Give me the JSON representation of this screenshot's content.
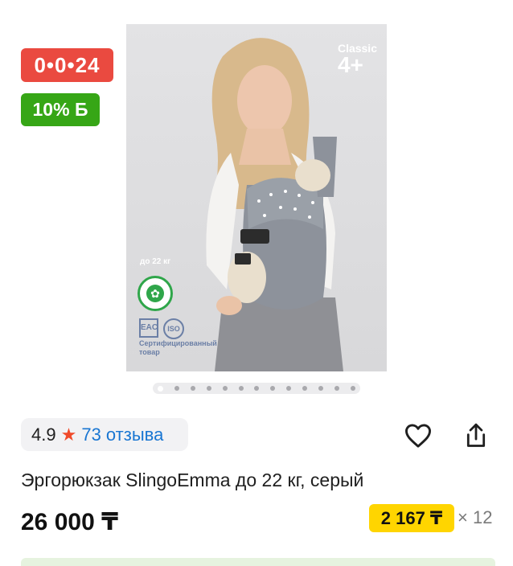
{
  "badges": {
    "timer": "0•0•24",
    "bonus": "10% Б"
  },
  "product_image": {
    "series": "Classic",
    "age": "4+",
    "weight_label": "до 22 кг",
    "cotton_badge": "100% COTTON",
    "cert_logos": [
      "EAC",
      "ISO"
    ],
    "certified_text": "Сертифицированный товар",
    "slides_total": 13,
    "slide_active": 1
  },
  "rating": {
    "score": "4.9",
    "reviews": "73 отзыва"
  },
  "actions": {
    "favorite_icon": "heart-icon",
    "share_icon": "share-icon"
  },
  "product": {
    "title": "Эргорюкзак SlingoEmma до 22 кг, серый",
    "price": "26 000 ₸",
    "installment_price": "2 167 ₸",
    "installment_months": "× 12"
  },
  "colors": {
    "timer_badge": "#ea4a40",
    "bonus_badge": "#36a616",
    "rating_star": "#f04a2a",
    "reviews_link": "#1976d2",
    "installment_badge": "#ffd500"
  }
}
